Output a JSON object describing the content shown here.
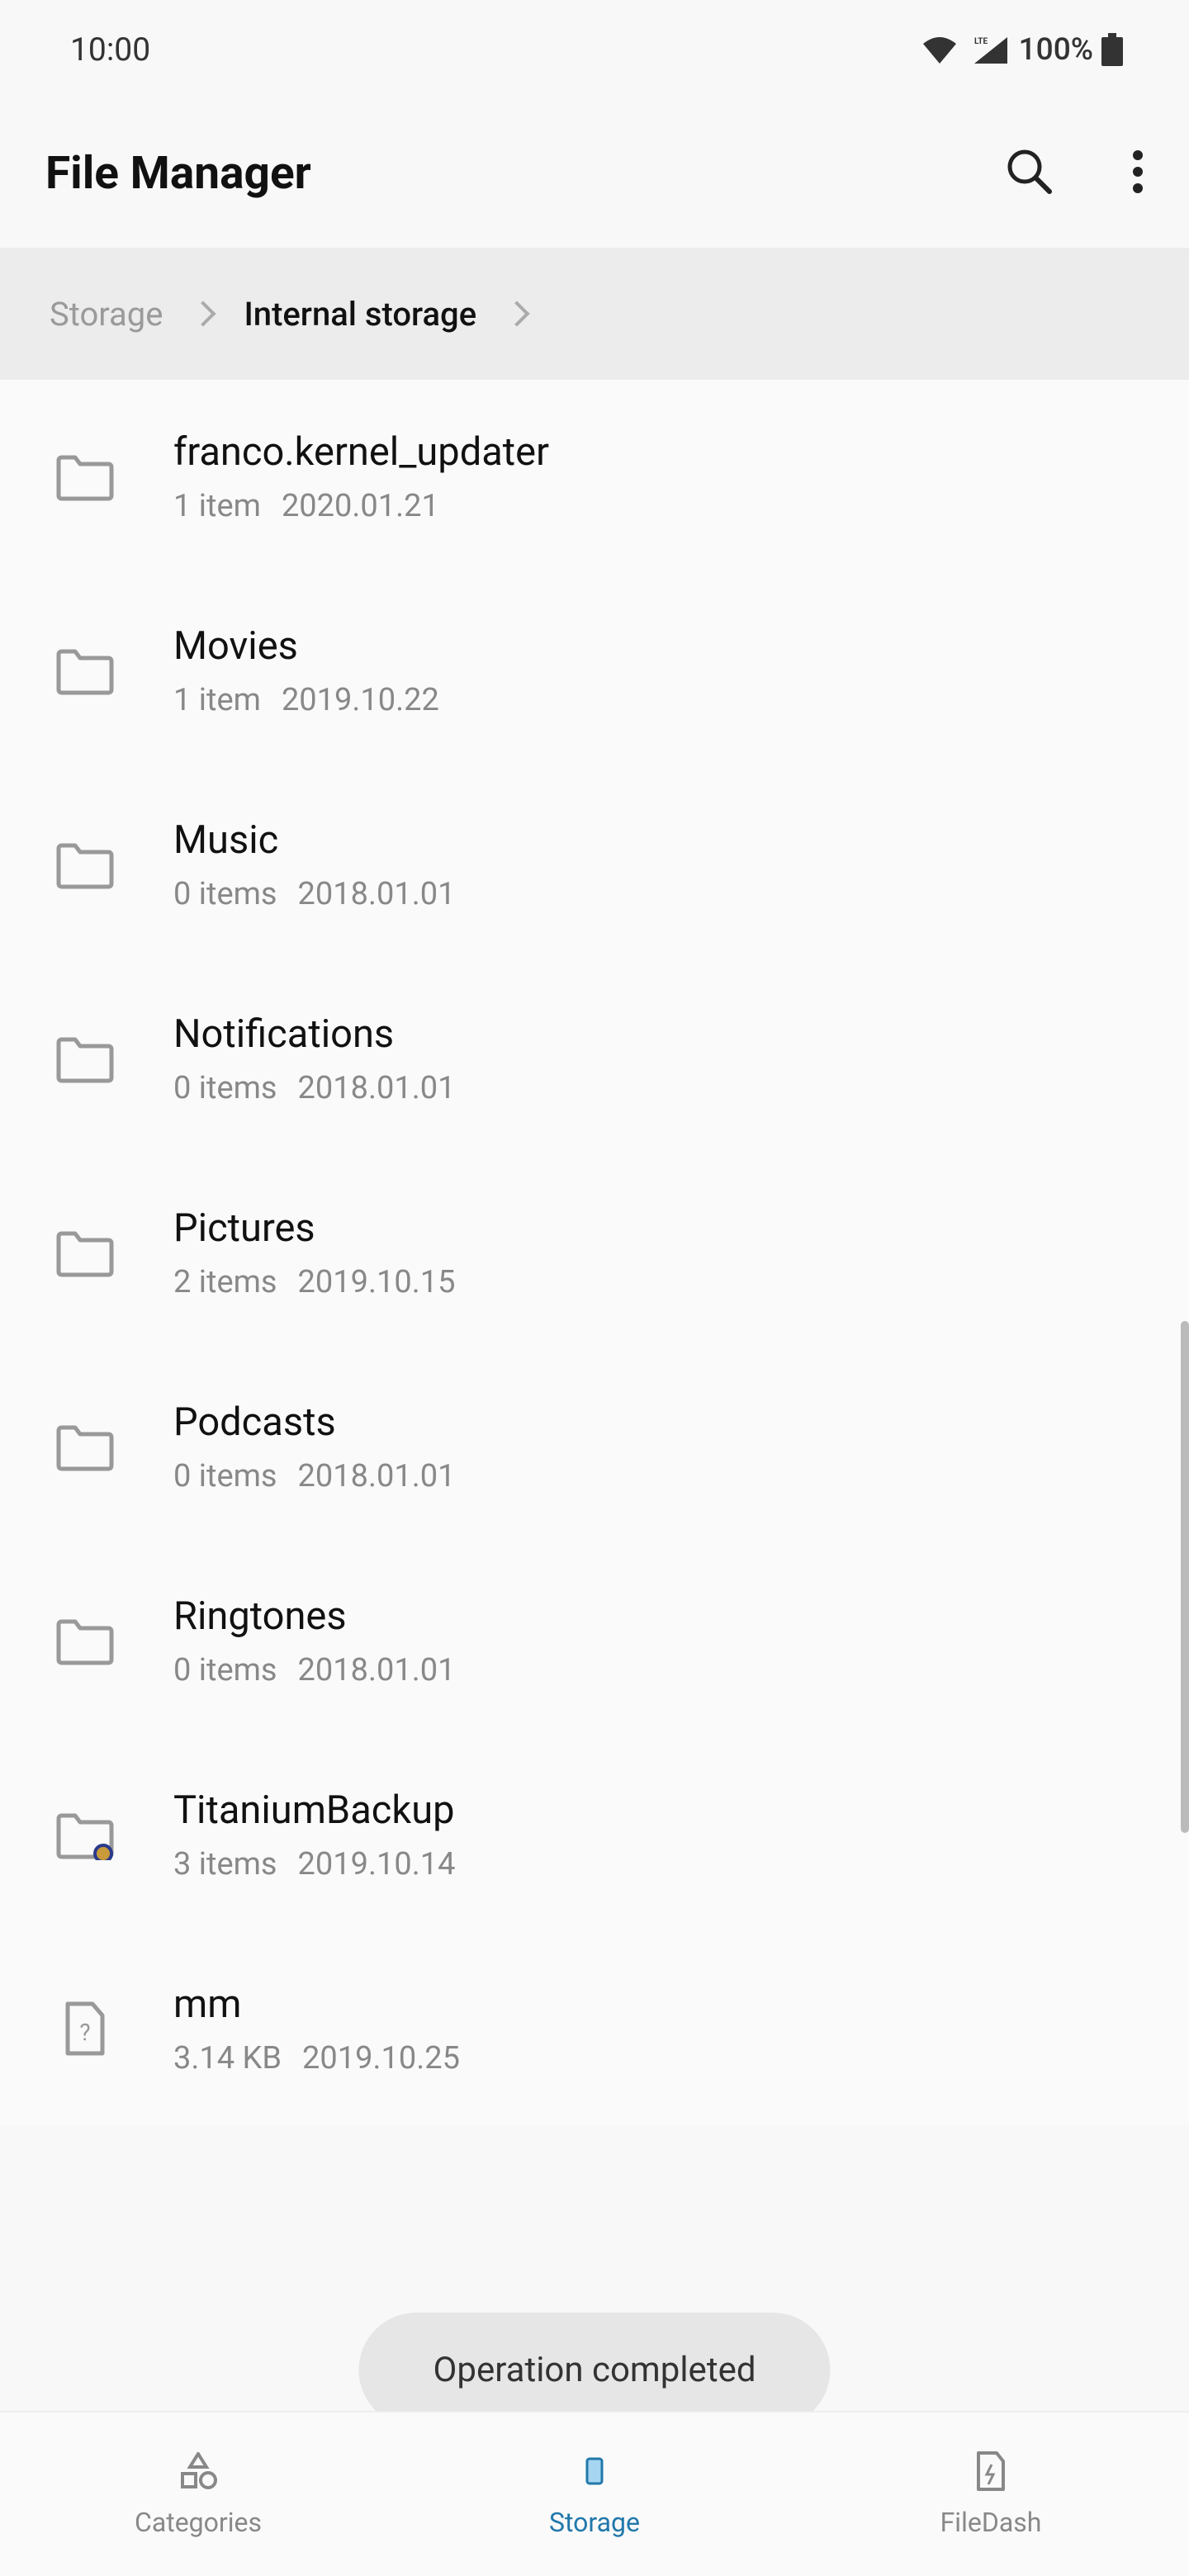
{
  "status": {
    "time": "10:00",
    "battery": "100%",
    "lte": "LTE"
  },
  "header": {
    "title": "File Manager"
  },
  "breadcrumb": {
    "root": "Storage",
    "current": "Internal storage"
  },
  "items": [
    {
      "name": "franco.kernel_updater",
      "info": "1 item",
      "date": "2020.01.21",
      "type": "folder",
      "badge": false
    },
    {
      "name": "Movies",
      "info": "1 item",
      "date": "2019.10.22",
      "type": "folder",
      "badge": false
    },
    {
      "name": "Music",
      "info": "0 items",
      "date": "2018.01.01",
      "type": "folder",
      "badge": false
    },
    {
      "name": "Notifications",
      "info": "0 items",
      "date": "2018.01.01",
      "type": "folder",
      "badge": false
    },
    {
      "name": "Pictures",
      "info": "2 items",
      "date": "2019.10.15",
      "type": "folder",
      "badge": false
    },
    {
      "name": "Podcasts",
      "info": "0 items",
      "date": "2018.01.01",
      "type": "folder",
      "badge": false
    },
    {
      "name": "Ringtones",
      "info": "0 items",
      "date": "2018.01.01",
      "type": "folder",
      "badge": false
    },
    {
      "name": "TitaniumBackup",
      "info": "3 items",
      "date": "2019.10.14",
      "type": "folder",
      "badge": true
    },
    {
      "name": "mm",
      "info": "3.14 KB",
      "date": "2019.10.25",
      "type": "file",
      "badge": false
    }
  ],
  "toast": "Operation completed",
  "nav": {
    "items": [
      {
        "label": "Categories",
        "key": "categories"
      },
      {
        "label": "Storage",
        "key": "storage"
      },
      {
        "label": "FileDash",
        "key": "filedash"
      }
    ],
    "active": "storage"
  }
}
